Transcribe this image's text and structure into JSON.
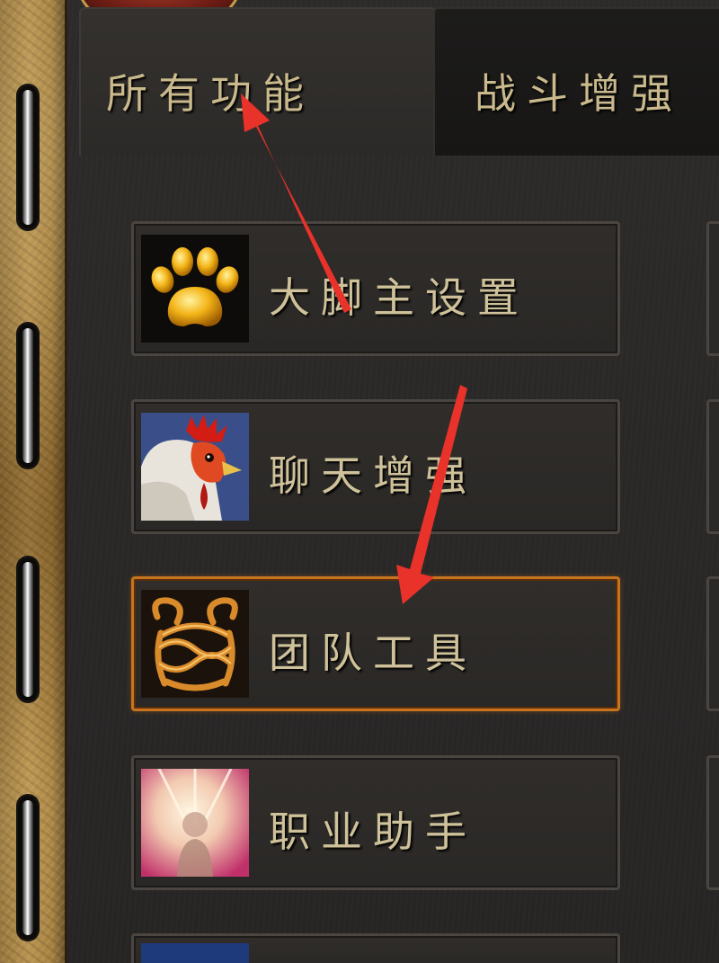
{
  "tabs": [
    {
      "label": "所有功能",
      "active": true
    },
    {
      "label": "战斗增强",
      "active": false
    }
  ],
  "menu": {
    "items": [
      {
        "label": "大脚主设置",
        "icon": "paw-icon"
      },
      {
        "label": "聊天增强",
        "icon": "rooster-icon"
      },
      {
        "label": "团队工具",
        "icon": "ornate-knot-icon",
        "selected": true
      },
      {
        "label": "职业助手",
        "icon": "holy-light-icon"
      }
    ]
  },
  "colors": {
    "selected_border": "#c8741e",
    "arrow": "#e8322a",
    "text": "#cfc29a"
  }
}
